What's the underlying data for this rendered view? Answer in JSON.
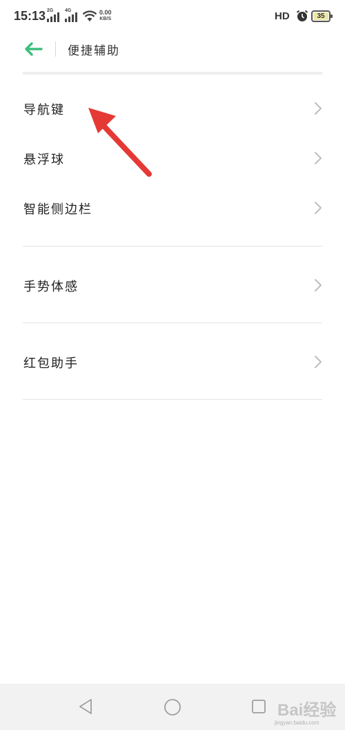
{
  "status_bar": {
    "time": "15:13",
    "signal1_tag": "2G",
    "signal2_tag": "4G",
    "speed_value": "0.00",
    "speed_unit": "KB/S",
    "hd_label": "HD",
    "battery_level": "35",
    "icons": [
      "signal-bars-icon",
      "wifi-icon",
      "alarm-clock-icon",
      "battery-icon"
    ]
  },
  "header": {
    "title": "便捷辅助",
    "back_icon": "arrow-left-icon",
    "accent_color": "#3dbd7d"
  },
  "menu": {
    "items": [
      {
        "label": "导航键"
      },
      {
        "label": "悬浮球"
      },
      {
        "label": "智能侧边栏"
      },
      {
        "label": "手势体感"
      },
      {
        "label": "红包助手"
      }
    ],
    "chevron_icon": "chevron-right-icon"
  },
  "annotation": {
    "arrow_color": "#e53935",
    "arrow_icon": "red-pointer-arrow-icon"
  },
  "nav_bar": {
    "icons": [
      "triangle-back-icon",
      "circle-home-icon",
      "square-recents-icon"
    ]
  },
  "watermark": {
    "text": "Bai经验",
    "sub": "jingyan.baidu.com"
  }
}
